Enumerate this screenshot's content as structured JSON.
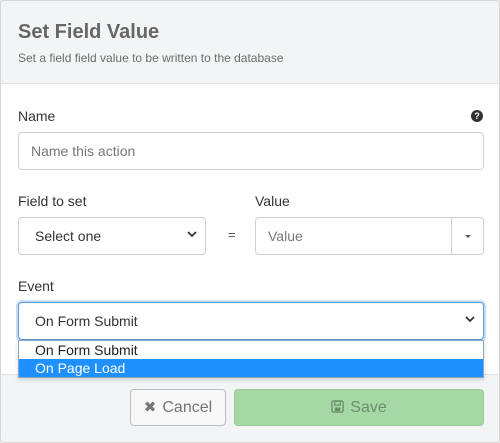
{
  "dialog": {
    "title": "Set Field Value",
    "subtitle": "Set a field field value to be written to the database"
  },
  "name": {
    "label": "Name",
    "placeholder": "Name this action",
    "help_icon": "question-circle-icon"
  },
  "field_to_set": {
    "label": "Field to set",
    "selected": "Select one"
  },
  "equals": "=",
  "value": {
    "label": "Value",
    "placeholder": "Value"
  },
  "event": {
    "label": "Event",
    "selected": "On Form Submit",
    "options": [
      "On Form Submit",
      "On Page Load"
    ],
    "highlighted": "On Page Load"
  },
  "footer": {
    "cancel_label": "Cancel",
    "cancel_icon": "times-icon",
    "save_label": "Save",
    "save_icon": "floppy-disk-icon"
  },
  "colors": {
    "save_bg": "#a6d8a6",
    "highlight": "#1e90ff",
    "focus_border": "#5b9bd5"
  }
}
